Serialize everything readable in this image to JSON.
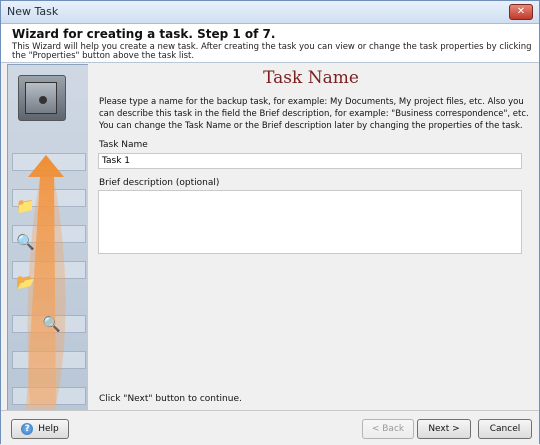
{
  "window": {
    "title": "New Task",
    "close_symbol": "✕"
  },
  "header": {
    "title": "Wizard for creating a task. Step 1 of 7.",
    "description": "This Wizard will help you create a new task. After creating the task you can view or change the task properties by clicking the \"Properties\" button above the task list."
  },
  "main": {
    "title": "Task Name",
    "description": "Please type a name for the backup task, for example: My Documents, My project files, etc. Also you can describe this task in the field the Brief description, for example: \"Business correspondence\", etc. You can change the Task Name or the Brief description later by changing the properties of the task.",
    "task_name_label": "Task Name",
    "task_name_value": "Task 1",
    "brief_label": "Brief description (optional)",
    "brief_value": "",
    "hint": "Click \"Next\" button to continue."
  },
  "footer": {
    "help_label": "Help",
    "help_icon": "?",
    "back_label": "< Back",
    "next_label": "Next >",
    "cancel_label": "Cancel"
  }
}
